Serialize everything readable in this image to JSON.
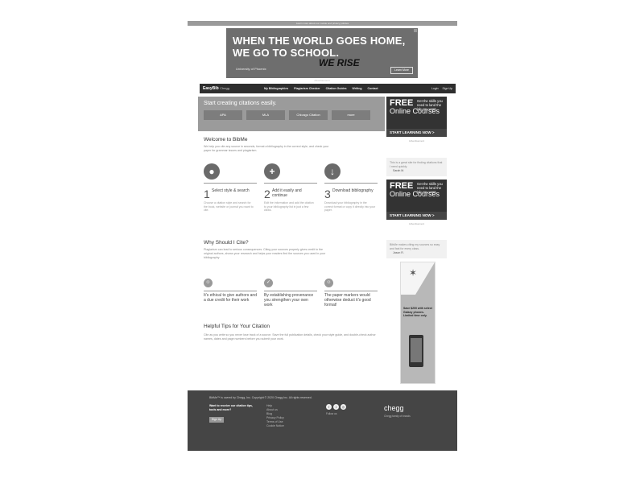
{
  "top_strip": "Learn more about our cookie and privacy policies",
  "banner": {
    "line1": "WHEN THE WORLD GOES HOME,",
    "line2": "WE GO TO SCHOOL.",
    "tagline": "WE RISE",
    "brand": "University of Phoenix",
    "cta": "Learn More",
    "caption": "Advertisement"
  },
  "nav": {
    "logo": "EasyBib",
    "logo_sub": "Chegg",
    "links": [
      "My Bibliographies",
      "Plagiarism Checker",
      "Citation Guides",
      "Writing",
      "Contact"
    ],
    "right": [
      "Login",
      "Sign Up"
    ]
  },
  "hero": {
    "title": "Start creating citations easily.",
    "buttons": [
      "APA",
      "MLA",
      "Chicago Citation",
      "more"
    ]
  },
  "welcome": {
    "title": "Welcome to BibMe",
    "text": "We help you cite any source in seconds, format a bibliography in the correct style, and check your paper for grammar issues and plagiarism."
  },
  "features": [
    {
      "icon": "●",
      "num": "1",
      "title": "Select style & search",
      "desc": "Choose a citation style and search for the book, website or journal you want to cite."
    },
    {
      "icon": "+",
      "num": "2",
      "title": "Add it easily and continue",
      "desc": "Edit the information and add the citation to your bibliography list in just a few clicks."
    },
    {
      "icon": "↓",
      "num": "3",
      "title": "Download bibliography",
      "desc": "Download your bibliography in the correct format or copy it directly into your paper."
    }
  ],
  "why": {
    "title": "Why Should I Cite?",
    "text": "Plagiarism can lead to serious consequences. Citing your sources properly gives credit to the original authors, shows your research and helps your readers find the sources you used in your bibliography."
  },
  "why_items": [
    {
      "icon": "☺",
      "title": "It's ethical to give authors and a due credit for their work"
    },
    {
      "icon": "✓",
      "title": "By establishing provenance you strengthen your own work"
    },
    {
      "icon": "☺",
      "title": "The paper markers would otherwise deduct it's good format!"
    }
  ],
  "tips": {
    "title": "Helpful Tips for Your Citation",
    "text": "Cite as you write so you never lose track of a source. Save the full publication details, check your style guide, and double-check author names, dates and page numbers before you submit your work."
  },
  "sidebar": {
    "ads": [
      {
        "free": "FREE",
        "oc": "Online Courses",
        "text": "Get the skills you need to land the job you want.",
        "cta": "START LEARNING NOW >"
      },
      {
        "free": "FREE",
        "oc": "Online Courses",
        "text": "Get the skills you need to land the job you want.",
        "cta": "START LEARNING NOW >"
      }
    ],
    "ad_caption": "Advertisement",
    "quotes": [
      {
        "text": "This is a great site for finding citations that I need quickly.",
        "who": "Sarah M."
      },
      {
        "text": "BibMe makes citing my sources so easy and fast for every class.",
        "who": "Jason R."
      }
    ],
    "sky_text": "Save $200 with select Galaxy phones. Limited time only."
  },
  "footer": {
    "copy": "BibMe™ is owned by Chegg, Inc. Copyright © 2020 Chegg Inc. All rights reserved.",
    "subscribe": "Want to receive our citation tips, tools and more?",
    "signup": "Sign Up",
    "links": [
      "Help",
      "About us",
      "Blog",
      "Privacy Policy",
      "Terms of Use",
      "Cookie Notice"
    ],
    "follow": "Follow us",
    "chegg": "chegg",
    "chegg_sub": "Chegg family of brands"
  }
}
